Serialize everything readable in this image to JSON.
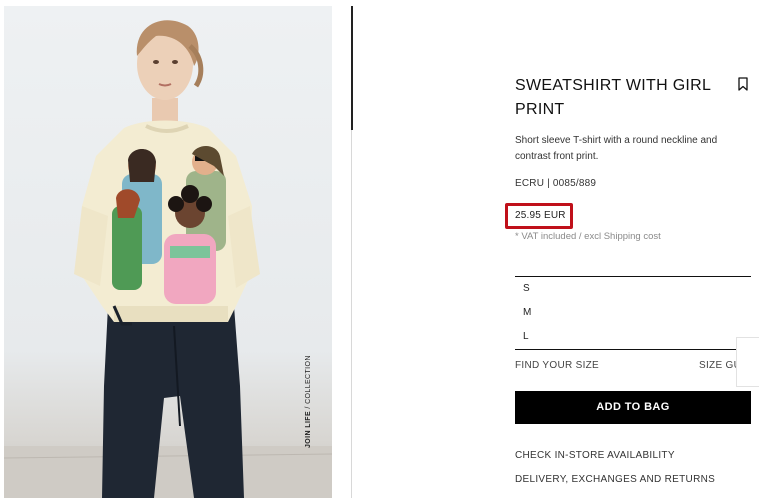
{
  "product": {
    "title": "SWEATSHIRT WITH GIRL PRINT",
    "description": "Short sleeve T-shirt with a round neckline and contrast front print.",
    "color_ref": "ECRU | 0085/889",
    "price": "25.95 EUR",
    "vat_note": "* VAT included / excl Shipping cost"
  },
  "image": {
    "tag_bold": "JOIN LIFE",
    "tag_rest": " / COLLECTION"
  },
  "sizes": [
    "S",
    "M",
    "L"
  ],
  "size_links": {
    "find": "FIND YOUR SIZE",
    "guide": "SIZE GU"
  },
  "actions": {
    "add_to_bag": "ADD TO BAG",
    "store_availability": "CHECK IN-STORE AVAILABILITY",
    "delivery": "DELIVERY, EXCHANGES AND RETURNS"
  },
  "icons": {
    "bookmark": "bookmark-icon"
  },
  "colors": {
    "price_highlight": "#c0101a",
    "button_bg": "#000000",
    "sweatshirt": "#f3ecd2"
  }
}
